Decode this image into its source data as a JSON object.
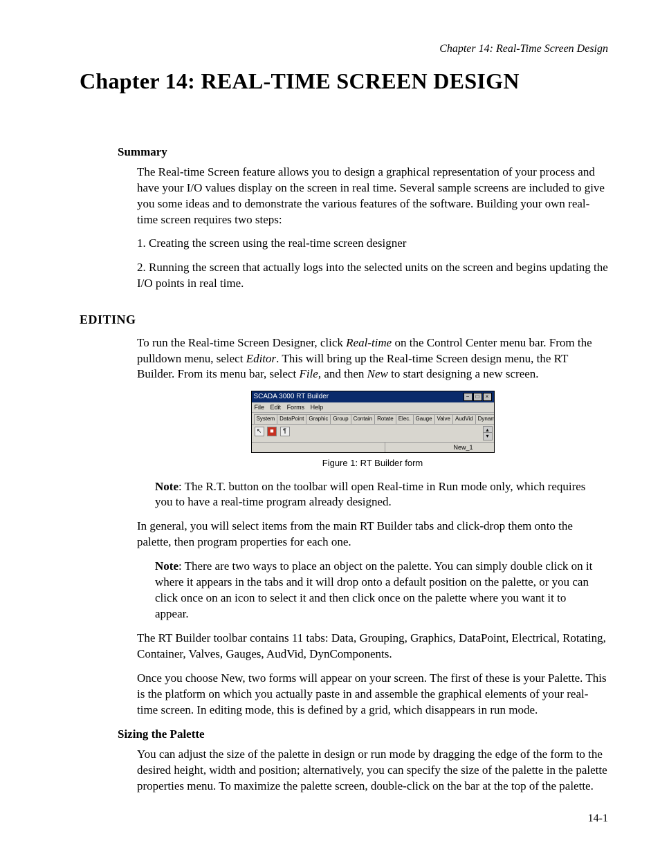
{
  "running_head": "Chapter 14: Real-Time Screen Design",
  "chapter_title_prefix": "Chapter 14: ",
  "chapter_title_caps": "REAL-TIME SCREEN DESIGN",
  "summary": {
    "heading": "Summary",
    "p1": "The Real-time Screen feature allows you to design a graphical representation of your process and have your I/O values display on the screen in real time. Several sample screens are included to give you some ideas and to demonstrate the various features of the software. Building your own real-time screen requires two steps:",
    "step1": "1. Creating the screen using the real-time screen designer",
    "step2": "2. Running the screen that actually logs into the selected units on the screen and begins updating the I/O points in real time."
  },
  "editing": {
    "heading": "EDITING",
    "p1_a": "To run the Real-time Screen Designer, click ",
    "p1_rt": "Real-time",
    "p1_b": " on the Control Center menu bar.  From the pulldown menu, select ",
    "p1_editor": "Editor",
    "p1_c": ". This will bring up the Real-time Screen design menu, the RT Builder. From its menu bar, select ",
    "p1_file": "File",
    "p1_d": ", and then ",
    "p1_new": "New",
    "p1_e": " to start designing a new screen.",
    "note1_label": "Note",
    "note1": ": The R.T. button on the toolbar will open Real-time in Run mode only, which requires you to have a real-time program already designed.",
    "p2": "In general, you will select items from the main RT Builder tabs and click-drop them onto the palette, then program properties for each one.",
    "note2_label": "Note",
    "note2": ": There are two ways to place an object on the palette. You can simply double click on it where it appears in the tabs and it will drop onto a default position on the palette, or you can click once on an icon to select it and then click once on the palette where you want it to appear.",
    "p3": "The RT Builder toolbar contains 11 tabs: Data, Grouping, Graphics, DataPoint, Electrical, Rotating, Container, Valves, Gauges, AudVid, DynComponents.",
    "p4": "Once you choose New, two forms will appear on your screen. The first of these is your Palette. This is the platform on which you actually paste in and assemble the graphical elements of your real-time screen. In editing mode, this is defined by a grid, which disappears in run mode."
  },
  "sizing": {
    "heading": "Sizing the Palette",
    "p1": "You can adjust the size of the palette in design or run mode by dragging the edge of the form to the desired height, width and position; alternatively, you can specify the size of the palette in the palette properties menu. To maximize the palette screen, double-click on the bar at the top of the palette."
  },
  "figure": {
    "caption": "Figure 1: RT Builder form",
    "title": "SCADA 3000 RT Builder",
    "menus": {
      "file": "File",
      "edit": "Edit",
      "forms": "Forms",
      "help": "Help"
    },
    "tabs": [
      "System",
      "DataPoint",
      "Graphic",
      "Group",
      "Contain",
      "Rotate",
      "Elec.",
      "Gauge",
      "Valve",
      "AudVid",
      "Dynamic"
    ],
    "status": "New_1"
  },
  "page_number": "14-1"
}
